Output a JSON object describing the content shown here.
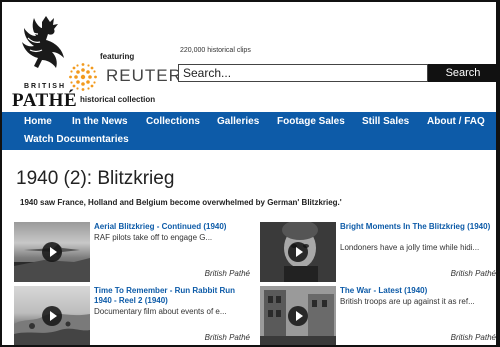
{
  "header": {
    "brand_small": "BRITISH",
    "brand_large": "PATHÉ",
    "featuring": "featuring",
    "partner": "REUTERS",
    "partner_mark": "®",
    "collection": "historical collection",
    "clip_count": "220,000 historical clips",
    "search_placeholder": "Search...",
    "search_button": "Search"
  },
  "nav": {
    "items": [
      "Home",
      "In the News",
      "Collections",
      "Galleries",
      "Footage Sales",
      "Still Sales",
      "About / FAQ",
      "Watch Documentaries"
    ]
  },
  "page": {
    "title": "1940 (2): Blitzkrieg",
    "subtitle": "1940 saw France, Holland and Belgium become overwhelmed by German' Blitzkrieg.'"
  },
  "cards": [
    {
      "title": "Aerial Blitzkrieg - Continued (1940)",
      "description": "RAF pilots take off to engage G...",
      "source": "British Pathé"
    },
    {
      "title": "Bright Moments In The Blitzkrieg (1940)",
      "description": "Londoners have a jolly time while hidi...",
      "source": "British Pathé"
    },
    {
      "title": "Time To Remember - Run Rabbit Run 1940 - Reel 2 (1940)",
      "description": "Documentary film about events of e...",
      "source": "British Pathé"
    },
    {
      "title": "The War - Latest (1940)",
      "description": "British troops are up against it as ref...",
      "source": "British Pathé"
    }
  ],
  "colors": {
    "nav_background": "#0d5ba8",
    "link": "#0d5ba8",
    "search_button": "#111111"
  },
  "icons": {
    "logo": "rooster-icon",
    "partner_logo": "reuters-sun-icon",
    "play": "play-icon"
  }
}
